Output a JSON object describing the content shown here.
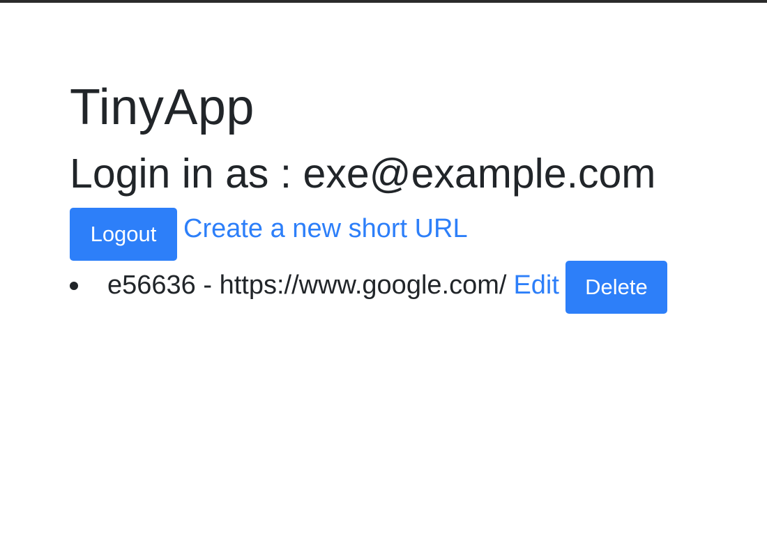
{
  "app": {
    "title": "TinyApp"
  },
  "session": {
    "login_text": "Login in as : exe@example.com"
  },
  "actions": {
    "logout_label": "Logout",
    "create_label": "Create a new short URL"
  },
  "urls": [
    {
      "text": "e56636 - https://www.google.com/",
      "edit_label": "Edit",
      "delete_label": "Delete"
    }
  ],
  "colors": {
    "accent": "#2d7ff9",
    "text": "#212529",
    "top_border": "#2b2b2b"
  }
}
